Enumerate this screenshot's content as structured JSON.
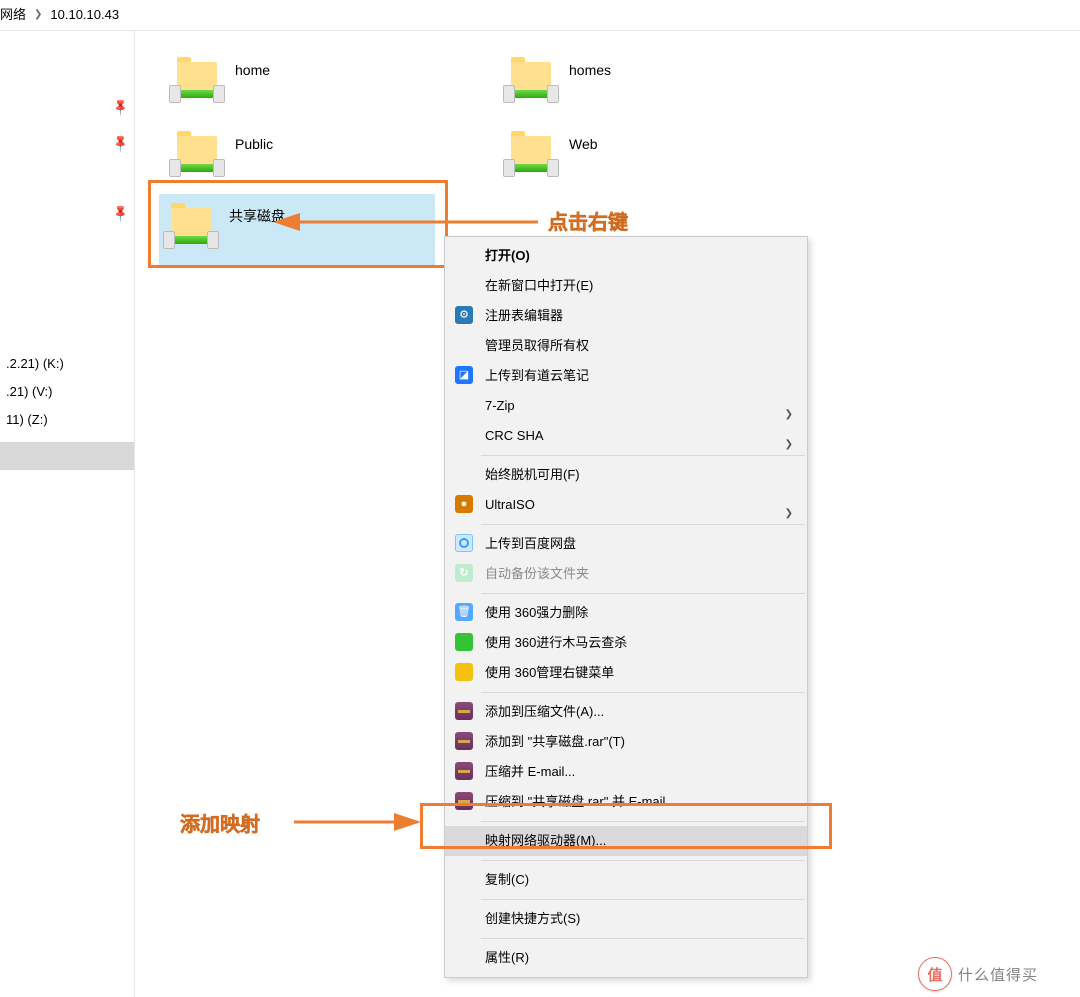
{
  "breadcrumb": {
    "root": "网络",
    "host": "10.10.10.43"
  },
  "leftPane": {
    "drives": [
      {
        "label": ".2.21) (K:)"
      },
      {
        "label": ".21) (V:)"
      },
      {
        "label": "11) (Z:)"
      }
    ]
  },
  "folders": {
    "f0": "home",
    "f1": "homes",
    "f2": "Public",
    "f3": "Web",
    "f4": "共享磁盘"
  },
  "annotations": {
    "rightClick": "点击右键",
    "addMap": "添加映射"
  },
  "ctx": {
    "open": "打开(O)",
    "newwin": "在新窗口中打开(E)",
    "regedit": "注册表编辑器",
    "adminOwn": "管理员取得所有权",
    "youdao": "上传到有道云笔记",
    "zip7": "7-Zip",
    "crc": "CRC SHA",
    "offline": "始终脱机可用(F)",
    "uiso": "UltraISO",
    "baidu": "上传到百度网盘",
    "autobackup": "自动备份该文件夹",
    "del360": "使用 360强力删除",
    "trojan360": "使用 360进行木马云查杀",
    "rmenu360": "使用 360管理右键菜单",
    "rarAdd": "添加到压缩文件(A)...",
    "rarAddTo": "添加到 \"共享磁盘.rar\"(T)",
    "rarEmail": "压缩并 E-mail...",
    "rarEmailTo": "压缩到 \"共享磁盘.rar\" 并 E-mail",
    "mapDrive": "映射网络驱动器(M)...",
    "copy": "复制(C)",
    "shortcut": "创建快捷方式(S)",
    "props": "属性(R)"
  },
  "watermark": {
    "ball": "值",
    "text": "什么值得买"
  }
}
